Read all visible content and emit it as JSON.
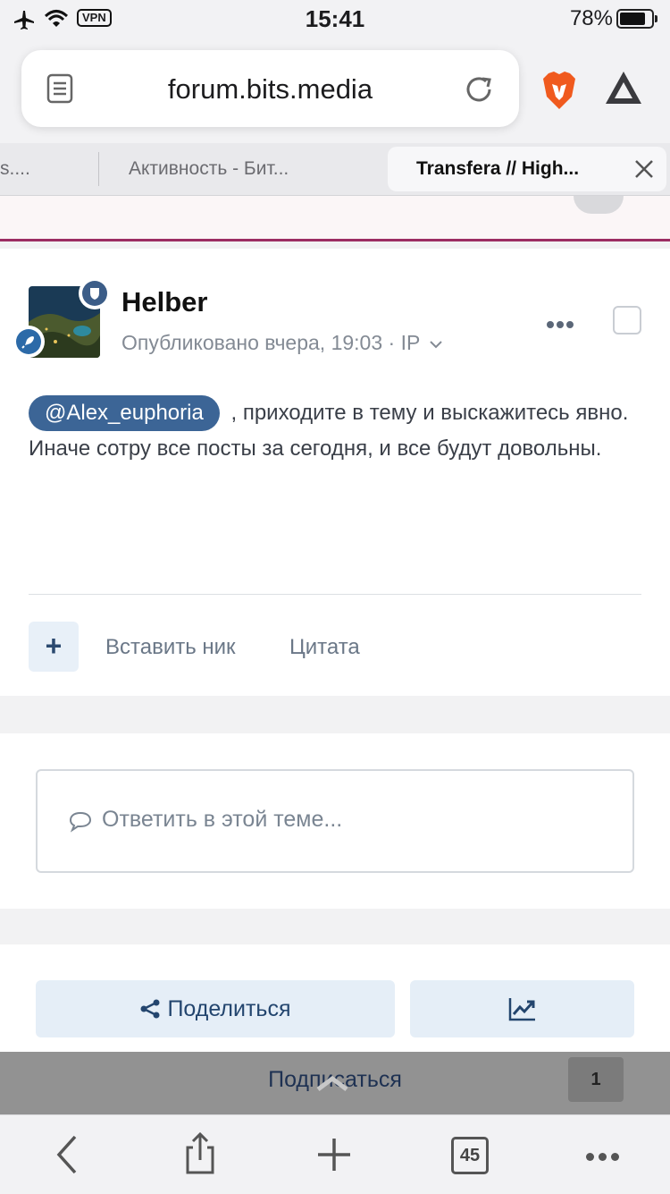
{
  "status_bar": {
    "vpn": "VPN",
    "time": "15:41",
    "battery": "78%"
  },
  "browser": {
    "url": "forum.bits.media",
    "tabs": [
      {
        "label": "s...."
      },
      {
        "label": "Активность - Бит..."
      },
      {
        "label": "Transfera // High..."
      }
    ],
    "tab_count": "45"
  },
  "post": {
    "author": "Helber",
    "meta": "Опубликовано вчера, 19:03 · IP",
    "mention": "@Alex_euphoria",
    "text_after_mention": ", приходите в тему и выскажитесь явно.",
    "text_line2": "Иначе сотру все посты за сегодня, и все будут довольны.",
    "actions": {
      "plus": "+",
      "insert_nick": "Вставить ник",
      "quote": "Цитата"
    }
  },
  "reply": {
    "placeholder": "Ответить в этой теме..."
  },
  "footer": {
    "share": "Поделиться",
    "subscribe": "Подписаться",
    "subscribe_count": "1"
  },
  "colors": {
    "accent": "#3c6596",
    "tab_border": "#9c2d62"
  }
}
